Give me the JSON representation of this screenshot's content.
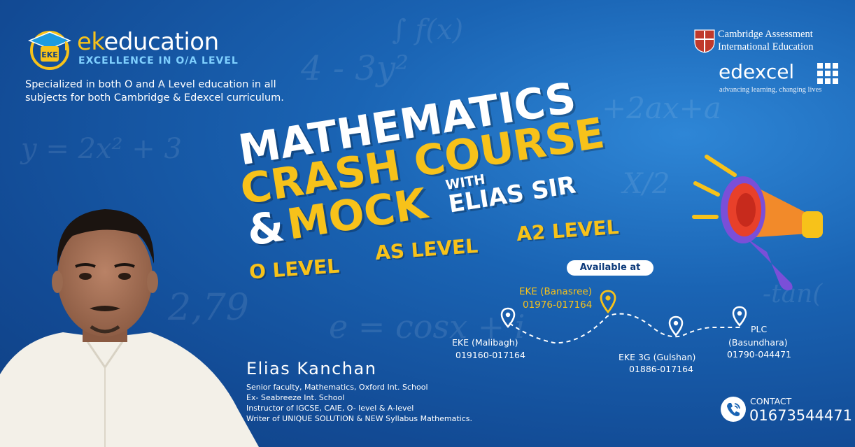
{
  "brand": {
    "name_prefix": "ek",
    "name_suffix": "education",
    "tagline": "EXCELLENCE IN O/A LEVEL",
    "logo_letters": "EKE"
  },
  "intro_text": "Specialized in both O and A Level education in all subjects for both Cambridge & Edexcel curriculum.",
  "partners": {
    "cambridge_line1": "Cambridge Assessment",
    "cambridge_line2": "International Education",
    "edexcel_name": "edexcel",
    "edexcel_tagline": "advancing learning, changing lives"
  },
  "headline": {
    "line1": "MATHEMATICS",
    "line2": "CRASH COURSE",
    "line3_amp": "&",
    "line3_mock": "MOCK",
    "with": "WITH",
    "teacher": "ELIAS  SIR"
  },
  "levels": [
    "O LEVEL",
    "AS LEVEL",
    "A2 LEVEL"
  ],
  "availability": {
    "label": "Available at",
    "locations": [
      {
        "name": "EKE (Malibagh)",
        "phone": "019160-017164",
        "highlight": false
      },
      {
        "name": "EKE (Banasree)",
        "phone": "01976-017164",
        "highlight": true
      },
      {
        "name": "EKE 3G (Gulshan)",
        "phone": "01886-017164",
        "highlight": false
      },
      {
        "name": "PLC",
        "name2": "(Basundhara)",
        "phone": "01790-044471",
        "highlight": false
      }
    ]
  },
  "instructor": {
    "name": "Elias Kanchan",
    "credentials": [
      "Senior faculty, Mathematics, Oxford Int. School",
      "Ex- Seabreeze Int. School",
      "Instructor of IGCSE, CAIE, O- level & A-level",
      "Writer of UNIQUE SOLUTION & NEW Syllabus Mathematics."
    ]
  },
  "contact": {
    "label": "CONTACT",
    "phone": "01673544471"
  },
  "colors": {
    "background": "#1a64b4",
    "accent_yellow": "#f7c21a",
    "brand_blue": "#7fd0ff",
    "megaphone_orange": "#f28a2a",
    "megaphone_purple": "#7a4fd8"
  },
  "icons": [
    "graduation-cap-icon",
    "cambridge-shield-icon",
    "edexcel-grid-icon",
    "map-pin-icon",
    "megaphone-icon",
    "phone-icon"
  ]
}
